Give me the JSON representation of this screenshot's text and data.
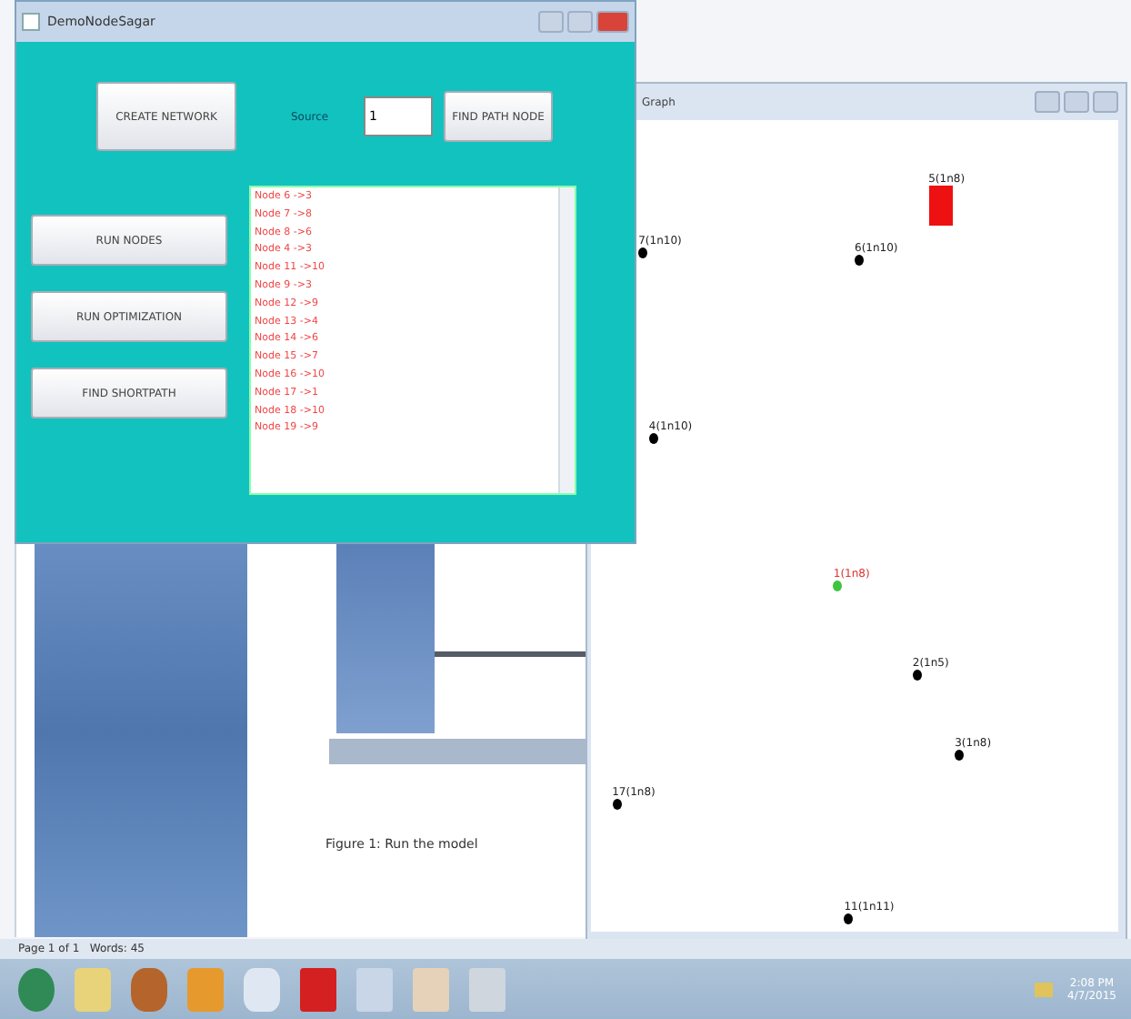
{
  "app_window": {
    "title": "DemoNodeSagar",
    "buttons": [
      {
        "label": "CREATE NETWORK"
      },
      {
        "label": "FIND PATH NODE"
      }
    ],
    "source_label": "Source",
    "source_value": "1",
    "side_buttons": [
      "RUN NODES",
      "RUN OPTIMIZATION",
      "FIND SHORTPATH"
    ],
    "list": [
      "Node 6 ->3",
      "Node 7 ->8",
      "Node 8 ->6",
      "Node 4 ->3",
      "Node 11 ->10",
      "Node 9 ->3",
      "Node 12 ->9",
      "Node 13 ->4",
      "Node 14 ->6",
      "Node 15 ->7",
      "Node 16 ->10",
      "Node 17 ->1",
      "Node 18 ->10",
      "Node 19 ->9"
    ]
  },
  "canvas_window": {
    "title": "Graph",
    "nodes": [
      {
        "label": "7(1n10)",
        "kind": "dot"
      },
      {
        "label": "6(1n10)",
        "kind": "dot"
      },
      {
        "label": "5(1n8)",
        "kind": "block"
      },
      {
        "label": "4(1n10)",
        "kind": "dot"
      },
      {
        "label": "1(1n8)",
        "kind": "source"
      },
      {
        "label": "2(1n5)",
        "kind": "dot"
      },
      {
        "label": "3(1n8)",
        "kind": "dot"
      },
      {
        "label": "17(1n8)",
        "kind": "dot"
      },
      {
        "label": "11(1n11)",
        "kind": "dot"
      }
    ]
  },
  "document": {
    "caption": "Figure 1: Run the model",
    "status": "Page 1 of 1   Words: 45"
  },
  "taskbar": {
    "time": "2:08 PM",
    "date": "4/7/2015"
  }
}
